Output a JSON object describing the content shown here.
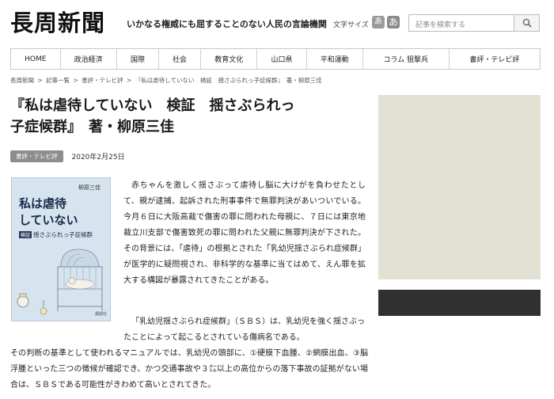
{
  "site": {
    "logo": "長周新聞",
    "tagline": "いかなる権威にも屈することのない人民の言論機関",
    "font_size_label": "文字サイズ",
    "font_small": "あ",
    "font_large": "あ"
  },
  "search": {
    "placeholder": "記事を検索する"
  },
  "nav": {
    "items": [
      {
        "label": "HOME"
      },
      {
        "label": "政治経済"
      },
      {
        "label": "国際"
      },
      {
        "label": "社会"
      },
      {
        "label": "教育文化"
      },
      {
        "label": "山口県"
      },
      {
        "label": "平和運動"
      },
      {
        "label": "コラム 狙撃兵"
      },
      {
        "label": "書評・テレビ評"
      }
    ]
  },
  "breadcrumb": {
    "items": [
      "長周新聞",
      "記事一覧",
      "書評・テレビ評",
      "『私は虐待していない　検証　揺さぶられっ子症候群』　著・柳原三佳"
    ],
    "separator": " > "
  },
  "article": {
    "title_line1": "『私は虐待していない　検証　揺さぶられっ",
    "title_line2": "子症候群』　著・柳原三佳",
    "category": "書評・テレビ評",
    "date": "2020年2月25日",
    "paragraph1": "赤ちゃんを激しく揺さぶって虐待し脳に大けがを負わせたとして、親が逮捕、起訴された刑事事件で無罪判決があいついでいる。今月６日に大阪高裁で傷害の罪に問われた母親に、７日には東京地裁立川支部で傷害致死の罪に問われた父親に無罪判決が下された。その背景には、「虐待」の根拠とされた「乳幼児揺さぶられ症候群」が医学的に疑問視され、非科学的な基準に当てはめて、えん罪を拡大する構図が暴露されてきたことがある。",
    "paragraph2_start": "「乳幼児揺さぶられ症候群」（ＳＢＳ）は、乳幼児を強く揺さぶったことによって起こるとされている傷病名である。",
    "paragraph2_rest": "その判断の基準として使われるマニュアルでは、乳幼児の頭部に、①硬膜下血腫、②網膜出血、③脳浮腫といった三つの徴候が確認でき、かつ交通事故や３㍍以上の高位からの落下事故の証拠がない場合は、ＳＢＳである可能性がきわめて高いとされてきた。"
  },
  "book": {
    "author": "柳原三佳",
    "title_line1": "私は虐待",
    "title_line2": "していない",
    "badge": "検証",
    "subtitle": "揺さぶられっ子症候群",
    "publisher": "講談社"
  },
  "colors": {
    "nav_border": "#c8c8c8",
    "category_badge": "#8d8d8d",
    "sidebar_beige": "#e3e1d3",
    "sidebar_dark": "#303030",
    "book_cover": "#d5e4ee"
  }
}
